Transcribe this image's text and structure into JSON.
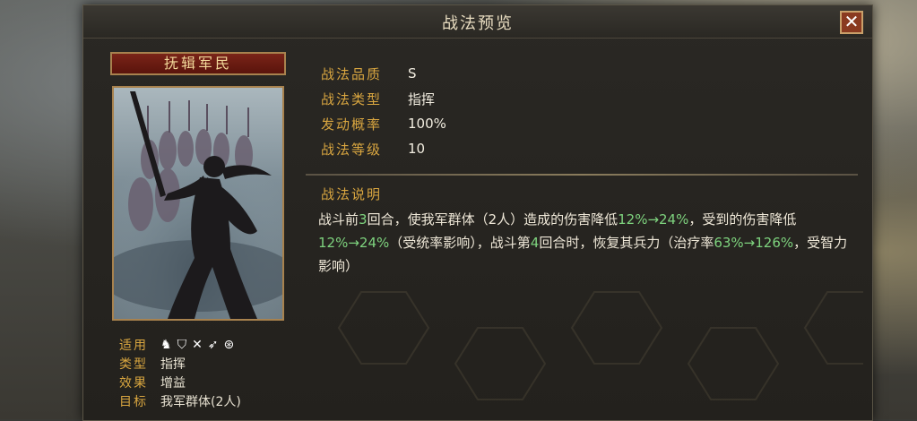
{
  "window": {
    "title": "战法预览",
    "close_label": "✕"
  },
  "skill": {
    "name": "抚辑军民",
    "stats": [
      {
        "label": "战法品质",
        "value": "S"
      },
      {
        "label": "战法类型",
        "value": "指挥"
      },
      {
        "label": "发动概率",
        "value": "100%"
      },
      {
        "label": "战法等级",
        "value": "10"
      }
    ],
    "description_title": "战法说明",
    "description_parts": [
      {
        "text": "战斗前",
        "hl": false
      },
      {
        "text": "3",
        "hl": true
      },
      {
        "text": "回合，使我军群体（2人）造成的伤害降低",
        "hl": false
      },
      {
        "text": "12%→24%",
        "hl": true
      },
      {
        "text": "，受到的伤害降低",
        "hl": false
      },
      {
        "text": "12%→24%",
        "hl": true
      },
      {
        "text": "（受统率影响），战斗第",
        "hl": false
      },
      {
        "text": "4",
        "hl": true
      },
      {
        "text": "回合时，恢复其兵力（治疗率",
        "hl": false
      },
      {
        "text": "63%→126%",
        "hl": true
      },
      {
        "text": "，受智力影响）",
        "hl": false
      }
    ],
    "meta": {
      "applicable_label": "适用",
      "applicable_icons": [
        "cavalry-icon",
        "shield-icon",
        "crossed-bows-icon",
        "spear-icon",
        "wheel-icon"
      ],
      "type_label": "类型",
      "type_value": "指挥",
      "effect_label": "效果",
      "effect_value": "增益",
      "target_label": "目标",
      "target_value": "我军群体(2人)"
    }
  },
  "colors": {
    "label_gold": "#d9a640",
    "highlight_green": "#7ed37e",
    "banner_red": "#7a2418"
  }
}
